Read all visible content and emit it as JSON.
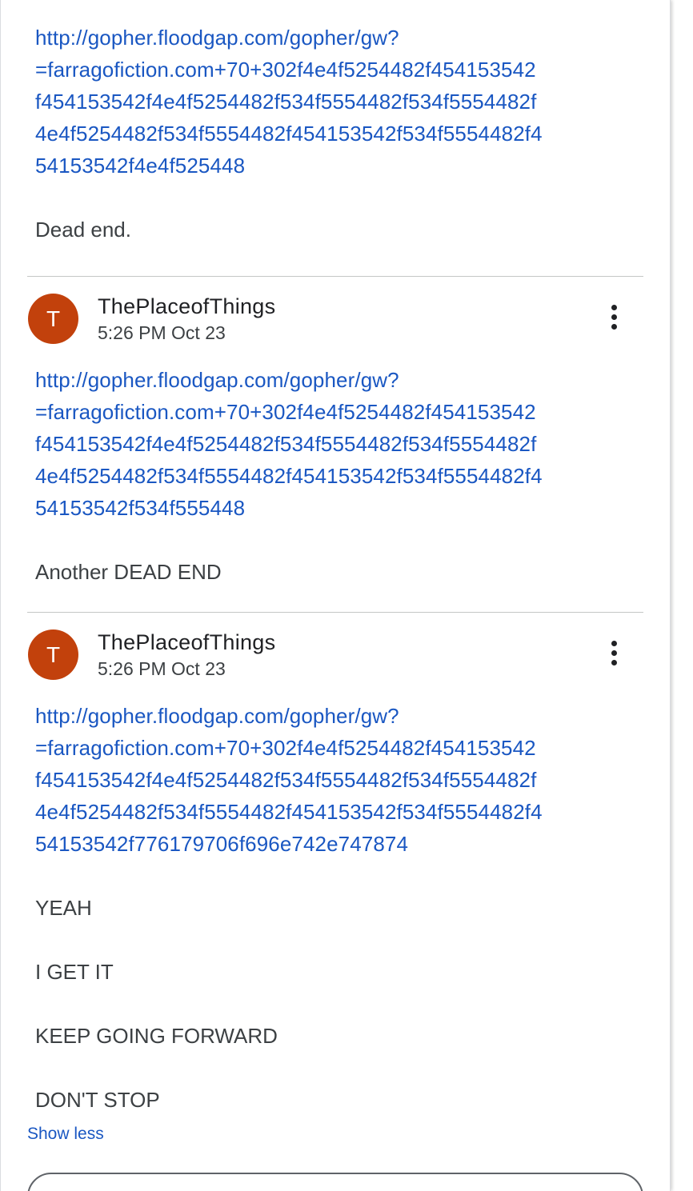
{
  "comments": [
    {
      "url_lines": [
        "http://gopher.floodgap.com/gopher/gw?",
        "=farragofiction.com+70+302f4e4f5254482f454153542",
        "f454153542f4e4f5254482f534f5554482f534f5554482f",
        "4e4f5254482f534f5554482f454153542f534f5554482f4",
        "54153542f4e4f525448"
      ],
      "paragraphs": [
        "Dead end."
      ]
    },
    {
      "avatar_letter": "T",
      "author": "ThePlaceofThings",
      "timestamp": "5:26 PM Oct 23",
      "menu_icon": "more-vert-icon",
      "url_lines": [
        "http://gopher.floodgap.com/gopher/gw?",
        "=farragofiction.com+70+302f4e4f5254482f454153542",
        "f454153542f4e4f5254482f534f5554482f534f5554482f",
        "4e4f5254482f534f5554482f454153542f534f5554482f4",
        "54153542f534f555448"
      ],
      "paragraphs": [
        "Another DEAD END"
      ]
    },
    {
      "avatar_letter": "T",
      "author": "ThePlaceofThings",
      "timestamp": "5:26 PM Oct 23",
      "menu_icon": "more-vert-icon",
      "url_lines": [
        "http://gopher.floodgap.com/gopher/gw?",
        "=farragofiction.com+70+302f4e4f5254482f454153542",
        "f454153542f4e4f5254482f534f5554482f534f5554482f",
        "4e4f5254482f534f5554482f454153542f534f5554482f4",
        "54153542f776179706f696e742e747874"
      ],
      "paragraphs": [
        "YEAH",
        "I GET IT",
        "KEEP GOING FORWARD",
        "DON'T STOP"
      ]
    }
  ],
  "show_less_label": "Show less",
  "colors": {
    "link": "#1a57c2",
    "avatar": "#c2410c",
    "text": "#3c4043"
  }
}
